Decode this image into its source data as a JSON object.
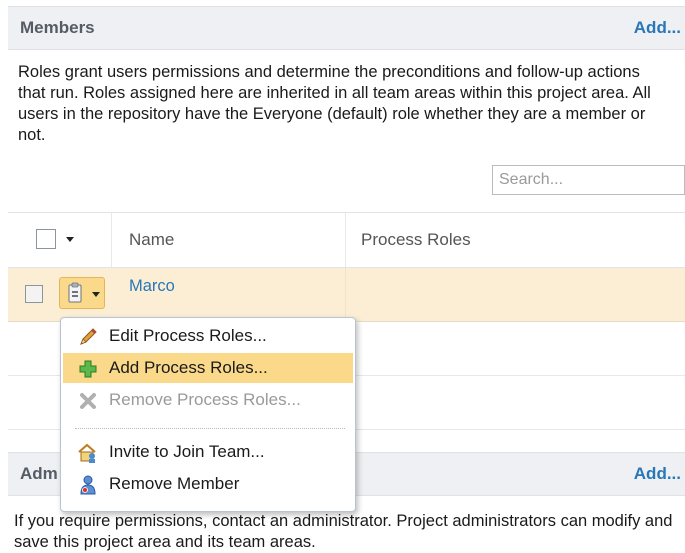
{
  "members": {
    "title": "Members",
    "add_label": "Add...",
    "description": "Roles grant users permissions and determine the preconditions and follow-up actions that run. Roles assigned here are inherited in all team areas within this project area. All users in the repository have the Everyone (default) role whether they are a member or not.",
    "search_placeholder": "Search...",
    "columns": [
      "Name",
      "Process Roles"
    ],
    "rows": [
      {
        "name": "Marco",
        "process_roles": ""
      }
    ]
  },
  "context_menu": {
    "items": [
      {
        "label": "Edit Process Roles...",
        "icon": "pencil-icon",
        "state": "normal"
      },
      {
        "label": "Add Process Roles...",
        "icon": "plus-icon",
        "state": "highlighted"
      },
      {
        "label": "Remove Process Roles...",
        "icon": "remove-x-icon",
        "state": "disabled"
      },
      {
        "label": "Invite to Join Team...",
        "icon": "team-invite-icon",
        "state": "normal"
      },
      {
        "label": "Remove Member",
        "icon": "user-remove-icon",
        "state": "normal"
      }
    ]
  },
  "administrators": {
    "title_partial": "Adm",
    "add_label": "Add...",
    "description": "If you require permissions, contact an administrator. Project administrators can modify and save this project area and its team areas."
  },
  "colors": {
    "link": "#2a77b8",
    "selected_row": "#fbeed5",
    "highlight": "#fbd98a"
  }
}
